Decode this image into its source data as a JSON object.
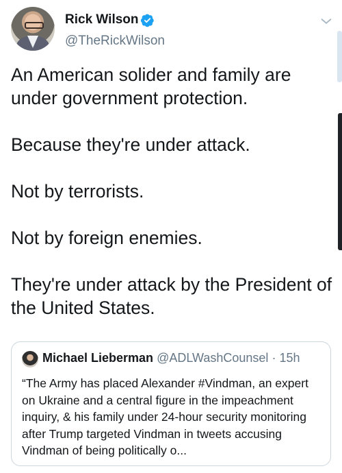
{
  "tweet": {
    "author_name": "Rick Wilson",
    "author_handle": "@TheRickWilson",
    "paragraphs": [
      "An American solider and family are under government protection.",
      "Because they're under attack.",
      "Not by terrorists.",
      "Not by foreign enemies.",
      "They're under attack by the President of the United States."
    ]
  },
  "quoted_tweet": {
    "author_name": "Michael Lieberman",
    "author_handle": "@ADLWashCounsel",
    "separator": "·",
    "time": "15h",
    "text": "“The Army has placed Alexander #Vindman, an expert on Ukraine and a central figure in the impeachment inquiry, & his family under 24-hour security monitoring after Trump targeted Vindman in tweets accusing Vindman of being politically o..."
  },
  "colors": {
    "verified_badge": "#1da1f2",
    "secondary_text": "#657786",
    "border": "#ccd6dd"
  },
  "icons": [
    "verified-badge-icon",
    "chevron-down-icon"
  ]
}
